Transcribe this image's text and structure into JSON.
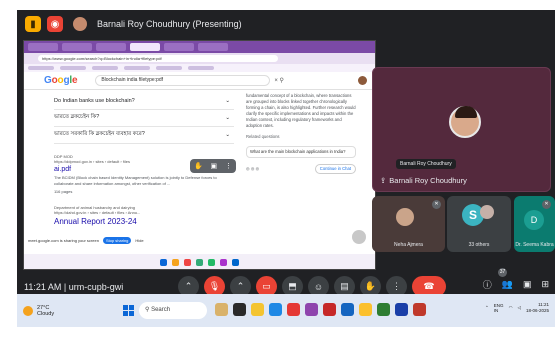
{
  "meet": {
    "presenting_title": "Barnali Roy Choudhury (Presenting)",
    "time": "11:21 AM",
    "separator": "|",
    "meeting_code": "urm-cupb-gwi",
    "participant_count_badge": "37"
  },
  "browser": {
    "url": "https://www.google.com/search?q=Blockchain+in+India+filetype:pdf",
    "search_query": "Blockchain india filetype:pdf",
    "people_also_ask": [
      "Do Indian banks use blockchain?",
      "ভারতে ব্লকচেইন কি?",
      "ভারতে সরকারি কি ব্লকচেইন ব্যবহার করে?"
    ],
    "result": {
      "source": "DDP MOD",
      "url_line": "https://ddpmod.gov.in › sites › default › files",
      "title": "ai.pdf",
      "snippet": "The BCIDM (Block chain based Identity Management) solution is jointly to Defense forces to collaborate and share information amongst, other verification of ...",
      "pages": "116 pages"
    },
    "result2": {
      "source": "Department of animal husbandry and dairying",
      "url_line": "https://dahd.gov.in › sites › default › files › Annu...",
      "title": "Annual Report 2023-24"
    },
    "ai_panel_text": "fundamental concept of a blockchain, where transactions are grouped into blocks linked together chronologically forming a chain, is also highlighted. Further research would clarify the specific implementations and impacts within the Indian context, including regulatory frameworks and adoption rates.",
    "related_label": "Related questions",
    "related_question": "What are the main blockchain applications in India?",
    "continue_chat": "Continue in Chat",
    "share_toast": "meet.google.com is sharing your screen",
    "stop_sharing": "Stop sharing",
    "hide": "Hide"
  },
  "participants": {
    "presenter_tooltip": "Barnali Roy Choudhury",
    "presenter_name": "Barnali Roy Choudhury",
    "tile1_name": "Neha Ajmera",
    "tile2_name": "33 others",
    "tile3_initial": "D",
    "tile3_name": "Dr. Seema Kabra"
  },
  "taskbar": {
    "temperature": "27°C",
    "weather_desc": "Cloudy",
    "search_placeholder": "Search",
    "language": "ENG",
    "region": "IN",
    "clock_time": "11:21",
    "clock_date": "18-06-2025"
  },
  "colors": {
    "meet_bg": "#202124",
    "hangup": "#ea4335",
    "presenter_tile": "#54293d"
  }
}
